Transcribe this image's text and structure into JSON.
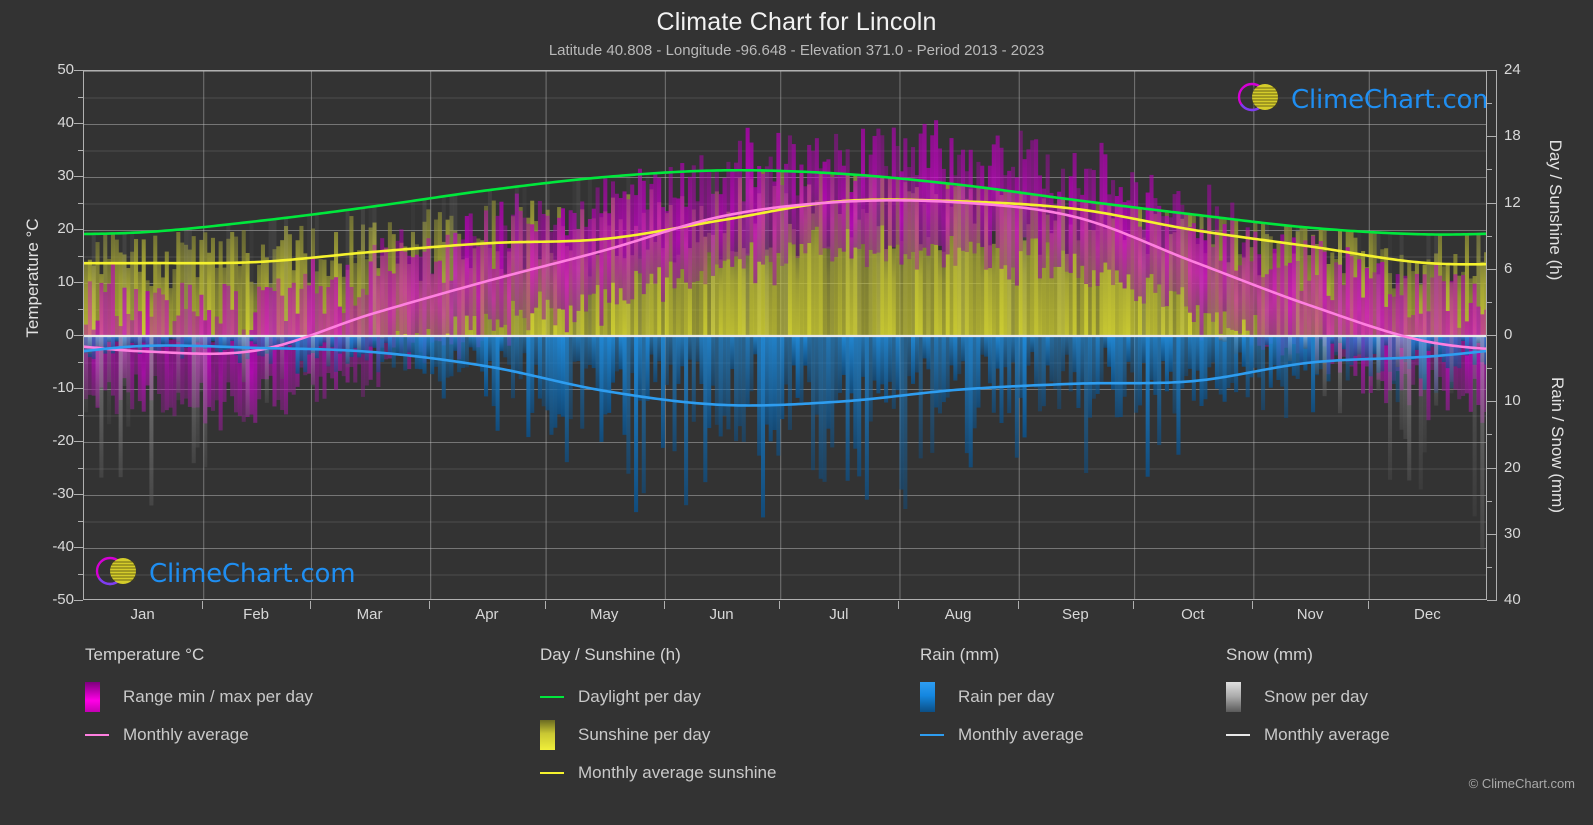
{
  "header": {
    "title": "Climate Chart for Lincoln",
    "subtitle": "Latitude 40.808 - Longitude -96.648 - Elevation 371.0 - Period 2013 - 2023"
  },
  "branding": {
    "logo_text": "ClimeChart.com",
    "copyright": "© ClimeChart.com"
  },
  "axes": {
    "left_label": "Temperature °C",
    "right_label_top": "Day / Sunshine (h)",
    "right_label_bottom": "Rain / Snow (mm)",
    "left_ticks": [
      "50",
      "40",
      "30",
      "20",
      "10",
      "0",
      "-10",
      "-20",
      "-30",
      "-40",
      "-50"
    ],
    "right_ticks_top": [
      "24",
      "18",
      "12",
      "6",
      "0"
    ],
    "right_ticks_bottom": [
      "10",
      "20",
      "30",
      "40"
    ],
    "x_ticks": [
      "Jan",
      "Feb",
      "Mar",
      "Apr",
      "May",
      "Jun",
      "Jul",
      "Aug",
      "Sep",
      "Oct",
      "Nov",
      "Dec"
    ]
  },
  "legend": {
    "groups": [
      {
        "title": "Temperature °C",
        "items": [
          {
            "label": "Range min / max per day",
            "swatch": "box",
            "color": "#ff00e6"
          },
          {
            "label": "Monthly average",
            "swatch": "line",
            "color": "#ff7fe0"
          }
        ]
      },
      {
        "title": "Day / Sunshine (h)",
        "items": [
          {
            "label": "Daylight per day",
            "swatch": "line",
            "color": "#00e83c"
          },
          {
            "label": "Sunshine per day",
            "swatch": "box",
            "color": "#f0ef3a"
          },
          {
            "label": "Monthly average sunshine",
            "swatch": "line",
            "color": "#f5f22e"
          }
        ]
      },
      {
        "title": "Rain (mm)",
        "items": [
          {
            "label": "Rain per day",
            "swatch": "box",
            "color": "#1487e0"
          },
          {
            "label": "Monthly average",
            "swatch": "line",
            "color": "#2e9df0"
          }
        ]
      },
      {
        "title": "Snow (mm)",
        "items": [
          {
            "label": "Snow per day",
            "swatch": "box",
            "color": "#d8d8d8"
          },
          {
            "label": "Monthly average",
            "swatch": "line",
            "color": "#e8e8e8"
          }
        ]
      }
    ]
  },
  "chart_data": {
    "type": "area",
    "title": "Climate Chart for Lincoln",
    "subtitle": "Latitude 40.808 - Longitude -96.648 - Elevation 371.0 - Period 2013 - 2023",
    "xlabel": "",
    "ylabel": "Temperature °C",
    "ylabel_right_top": "Day / Sunshine (h)",
    "ylabel_right_bottom": "Rain / Snow (mm)",
    "ylim": [
      -50,
      50
    ],
    "ylim_right_top": [
      0,
      24
    ],
    "ylim_right_bottom": [
      0,
      40
    ],
    "grid": true,
    "legend_position": "below",
    "categories": [
      "Jan",
      "Feb",
      "Mar",
      "Apr",
      "May",
      "Jun",
      "Jul",
      "Aug",
      "Sep",
      "Oct",
      "Nov",
      "Dec"
    ],
    "series": [
      {
        "name": "Daylight per day",
        "unit": "h",
        "color": "#00e83c",
        "axis": "right_top",
        "values": [
          9.4,
          10.4,
          11.7,
          13.2,
          14.4,
          15.0,
          14.7,
          13.7,
          12.3,
          11.0,
          9.8,
          9.2
        ]
      },
      {
        "name": "Monthly average sunshine",
        "unit": "h",
        "color": "#f5f22e",
        "axis": "right_top",
        "values": [
          6.6,
          6.7,
          7.6,
          8.4,
          8.8,
          10.5,
          12.2,
          12.2,
          11.5,
          9.6,
          8.1,
          6.6
        ]
      },
      {
        "name": "Monthly average temperature",
        "unit": "°C",
        "color": "#ff7fe0",
        "axis": "left",
        "values": [
          -2.9,
          -2.7,
          4.1,
          10.4,
          16.2,
          22.6,
          25.3,
          25.2,
          22.4,
          14.0,
          5.7,
          -1.1
        ]
      },
      {
        "name": "Monthly average rain",
        "unit": "mm",
        "color": "#2e9df0",
        "axis": "right_bottom",
        "values": [
          1.5,
          1.8,
          2.4,
          4.6,
          8.3,
          10.4,
          9.9,
          8.1,
          7.2,
          6.8,
          4.0,
          3.1
        ]
      }
    ],
    "daily_bands": [
      {
        "name": "Range min / max per day",
        "color": "#cc00cc",
        "axis": "left"
      },
      {
        "name": "Sunshine per day",
        "color": "#d4d431",
        "axis": "right_top"
      },
      {
        "name": "Rain per day",
        "color": "#1487e0",
        "axis": "right_bottom"
      },
      {
        "name": "Snow per day",
        "color": "#cccccc",
        "axis": "right_bottom"
      }
    ]
  }
}
